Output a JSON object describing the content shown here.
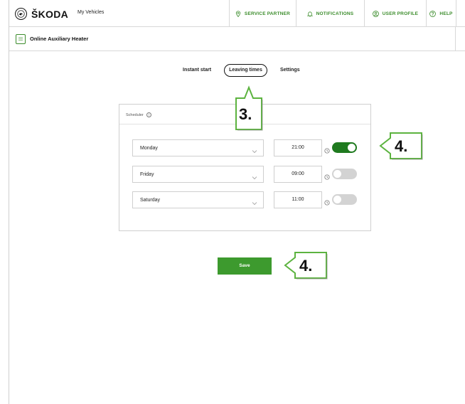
{
  "brand": {
    "name": "ŠKODA"
  },
  "topnav": {
    "my_vehicles": "My Vehicles",
    "service_partner": "SERVICE PARTNER",
    "notifications": "NOTIFICATIONS",
    "user_profile": "USER PROFILE",
    "help": "HELP"
  },
  "page": {
    "title": "Online Auxiliary Heater"
  },
  "tabs": [
    {
      "label": "Instant start",
      "active": false
    },
    {
      "label": "Leaving times",
      "active": true
    },
    {
      "label": "Settings",
      "active": false
    }
  ],
  "scheduler": {
    "title": "Scheduler",
    "rows": [
      {
        "day": "Monday",
        "time": "21:00",
        "enabled": true
      },
      {
        "day": "Friday",
        "time": "09:00",
        "enabled": false
      },
      {
        "day": "Saturday",
        "time": "11:00",
        "enabled": false
      }
    ]
  },
  "save_label": "Save",
  "callouts": {
    "tabs_step": "3.",
    "toggle_step": "4.",
    "save_step": "4."
  },
  "colors": {
    "accent": "#3b8c2b",
    "toggle_on": "#1f7a1f",
    "toggle_off": "#d3d3d3",
    "callout_border": "#5cb33f"
  }
}
